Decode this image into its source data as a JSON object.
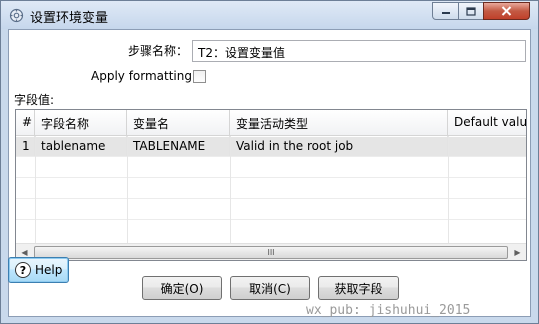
{
  "window": {
    "title": "设置环境变量",
    "icon": "variable-icon"
  },
  "form": {
    "step_name_label": "步骤名称：",
    "step_name_value": "T2：设置变量值",
    "apply_formatting_label": "Apply formatting",
    "apply_formatting_checked": false,
    "fields_label": "字段值:"
  },
  "grid": {
    "columns": [
      "#",
      "字段名称",
      "变量名",
      "变量活动类型",
      "Default valu"
    ],
    "rows": [
      [
        "1",
        "tablename",
        "TABLENAME",
        "Valid in the root job",
        ""
      ]
    ],
    "scroll_grip": "III"
  },
  "buttons": {
    "ok": "确定(O)",
    "cancel": "取消(C)",
    "get_fields": "获取字段",
    "help": "Help"
  },
  "watermark": "wx_pub: jishuhui_2015",
  "colors": {
    "frame": "#c9d9ec",
    "close_button": "#c0402a",
    "help_button": "#bee6fd"
  }
}
